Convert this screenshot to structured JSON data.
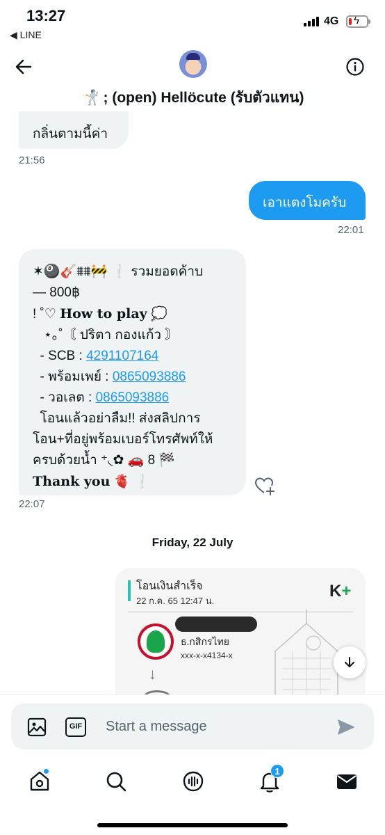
{
  "status_bar": {
    "time": "13:27",
    "back_app": "◀ LINE",
    "network": "4G",
    "battery_level": 0.15
  },
  "header": {
    "title": "🤺 ; (open) Hellöcute (รับตัวแทน)",
    "back_icon": "back-arrow-icon",
    "info_icon": "info-icon"
  },
  "messages": [
    {
      "direction": "in",
      "text": "กลิ่นตามนี้ค่า",
      "time": "21:56"
    },
    {
      "direction": "out",
      "text": "เอาแตงโมครับ",
      "time": "22:01"
    },
    {
      "direction": "in",
      "time": "22:07",
      "lines": {
        "l1": "✶🎱🎸⩩⩩🚧 ❕ รวมยอดค้าบ",
        "l2": "— 800฿",
        "l3a": "! ˚♡ ",
        "l3b": "How to play",
        "l3c": " 💭",
        "l4": "   ⋆｡˚〘 ปริตา กองแก้ว 〙",
        "scb_label": "  - SCB : ",
        "scb_number": "4291107164",
        "promptpay_label": "  - พร้อมเพย์ : ",
        "promptpay_number": "0865093886",
        "wallet_label": "  - วอเลต : ",
        "wallet_number": "0865093886",
        "l8": "  โอนแล้วอย่าลืม!! ส่งสลิปการ",
        "l9": "โอน+ที่อยู่พร้อมเบอร์โทรศัพท์ให้",
        "l10": "ครบด้วยน้ำ ⁺◟✿ 🚗 8 🏁",
        "l11a": "Thank you",
        "l11b": " 🫀 ❕"
      }
    }
  ],
  "date_divider": "Friday, 22 July",
  "slip": {
    "title": "โอนเงินสำเร็จ",
    "datetime": "22 ก.ค. 65  12:47 น.",
    "brand": "K",
    "brand_plus": "+",
    "bank_name": "ธ.กสิกรไทย",
    "account": "xxx-x-x4134-x"
  },
  "composer": {
    "placeholder": "Start a message",
    "gif_label": "GIF"
  },
  "bottom_nav": {
    "notifications_count": "1"
  },
  "colors": {
    "accent": "#1d9bf0",
    "bubble_in": "#eff3f4",
    "text": "#0f1419",
    "muted": "#536471",
    "battery_low": "#e0281b"
  }
}
